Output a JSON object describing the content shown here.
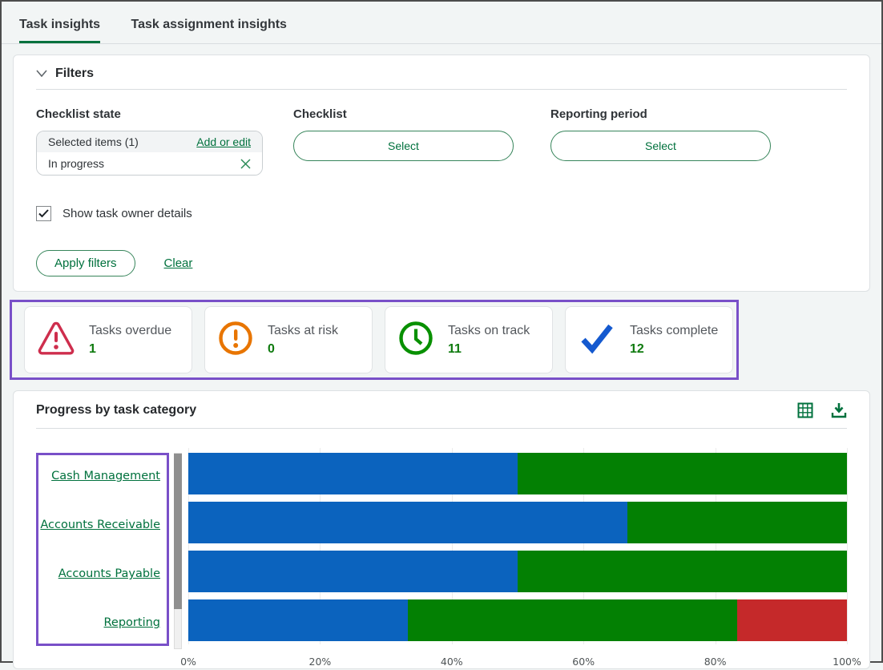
{
  "header": {
    "tabs": [
      {
        "label": "Task insights",
        "active": true
      },
      {
        "label": "Task assignment insights",
        "active": false
      }
    ]
  },
  "filters": {
    "title": "Filters",
    "checklist_state": {
      "label": "Checklist state",
      "selected_header": "Selected items (1)",
      "add_or_edit_link": "Add or edit",
      "selected_item": "In progress"
    },
    "checklist": {
      "label": "Checklist",
      "button": "Select"
    },
    "reporting_period": {
      "label": "Reporting period",
      "button": "Select"
    },
    "show_task_owner_details": {
      "label": "Show task owner details",
      "checked": true
    },
    "apply_button": "Apply filters",
    "clear_link": "Clear"
  },
  "stat_cards": [
    {
      "label": "Tasks overdue",
      "value": "1",
      "icon": "warning-triangle-icon",
      "icon_color": "#ce2e4d"
    },
    {
      "label": "Tasks at risk",
      "value": "0",
      "icon": "alert-circle-icon",
      "icon_color": "#e87500"
    },
    {
      "label": "Tasks on track",
      "value": "11",
      "icon": "clock-icon",
      "icon_color": "#089000"
    },
    {
      "label": "Tasks complete",
      "value": "12",
      "icon": "check-icon",
      "icon_color": "#1459cf"
    }
  ],
  "chart": {
    "title": "Progress by task category",
    "actions": [
      "table-view-icon",
      "download-icon"
    ]
  },
  "chart_data": {
    "type": "bar",
    "orientation": "horizontal",
    "stacked": true,
    "title": "Progress by task category",
    "categories": [
      "Cash Management",
      "Accounts Receivable",
      "Accounts Payable",
      "Reporting"
    ],
    "series": [
      {
        "name": "blue",
        "color": "#0b63be",
        "values": [
          50,
          66.7,
          50,
          33.3
        ]
      },
      {
        "name": "green",
        "color": "#038003",
        "values": [
          50,
          33.3,
          50,
          50
        ]
      },
      {
        "name": "red",
        "color": "#c5292a",
        "values": [
          0,
          0,
          0,
          16.7
        ]
      }
    ],
    "x_ticks": [
      "0%",
      "20%",
      "40%",
      "60%",
      "80%",
      "100%"
    ],
    "xlim": [
      0,
      100
    ],
    "grid": "vertical-20pct",
    "legend": "none"
  },
  "annotations": {
    "highlight_color": "#7950c8"
  }
}
